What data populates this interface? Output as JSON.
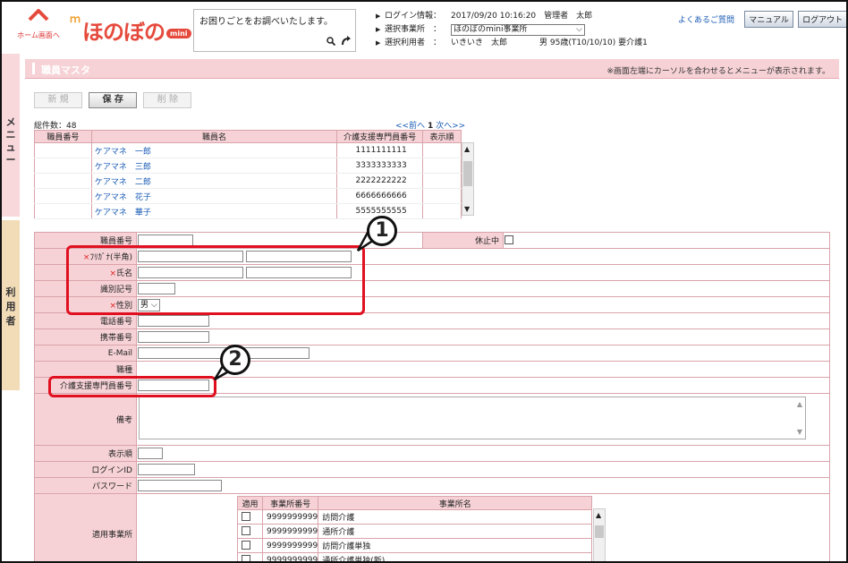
{
  "header": {
    "home_label": "ホーム画面へ",
    "logo_text": "ほのぼの",
    "logo_badge": "mini",
    "help_text": "お困りごとをお調べいたします。",
    "info": [
      {
        "key": "ログイン情報：",
        "value": "2017/09/20 10:16:20　管理者　太郎"
      },
      {
        "key": "選択事業所　：",
        "value": "ほのぼのmini事業所"
      },
      {
        "key": "選択利用者　：",
        "value": "いきいき　太郎　　　　男 95歳(T10/10/10) 要介護1"
      }
    ],
    "faq": "よくあるご質問",
    "manual": "マニュアル",
    "logout": "ログアウト"
  },
  "side": {
    "menu_label": [
      "メ",
      "ニ",
      "ュ",
      "ー"
    ],
    "user_label": [
      "利",
      "用",
      "者"
    ]
  },
  "page": {
    "title": "職員マスタ",
    "note": "※画面左端にカーソルを合わせるとメニューが表示されます。"
  },
  "actions": {
    "new": "新 規",
    "save": "保 存",
    "delete": "削 除"
  },
  "list": {
    "total": "総件数：48",
    "prev": "<<前へ",
    "page": "1",
    "next": "次へ>>",
    "headers": [
      "職員番号",
      "職員名",
      "介護支援専門員番号",
      "表示順"
    ],
    "rows": [
      {
        "no": "",
        "name": "ケアマネ　一郎",
        "care_no": "1111111111",
        "order": ""
      },
      {
        "no": "",
        "name": "ケアマネ　三郎",
        "care_no": "3333333333",
        "order": ""
      },
      {
        "no": "",
        "name": "ケアマネ　二郎",
        "care_no": "2222222222",
        "order": ""
      },
      {
        "no": "",
        "name": "ケアマネ　花子",
        "care_no": "6666666666",
        "order": ""
      },
      {
        "no": "",
        "name": "ケアマネ　華子",
        "care_no": "5555555555",
        "order": ""
      }
    ]
  },
  "form": {
    "staff_no": "職員番号",
    "on_leave": "休止中",
    "kana": "ﾌﾘｶﾞﾅ(半角)",
    "name": "氏名",
    "id_code": "識別記号",
    "gender": "性別",
    "gender_value": "男",
    "phone": "電話番号",
    "mobile": "携帯番号",
    "email": "E-Mail",
    "job": "職種",
    "care_manager_no": "介護支援専門員番号",
    "remarks": "備考",
    "display_order": "表示順",
    "login_id": "ログインID",
    "password": "パスワード",
    "offices_label": "適用事業所",
    "required_mark": "×"
  },
  "offices": {
    "headers": [
      "適用",
      "事業所番号",
      "事業所名"
    ],
    "rows": [
      {
        "no": "9999999999",
        "name": "訪問介護"
      },
      {
        "no": "9999999999",
        "name": "通所介護"
      },
      {
        "no": "9999999999",
        "name": "訪問介護単独"
      },
      {
        "no": "9999999999",
        "name": "通所介護単独(新)"
      }
    ]
  },
  "annotations": {
    "one": "1",
    "two": "2"
  },
  "colors": {
    "accent": "#e54a3c",
    "header_pink": "#f6d2d6",
    "callout": "#e01020"
  }
}
